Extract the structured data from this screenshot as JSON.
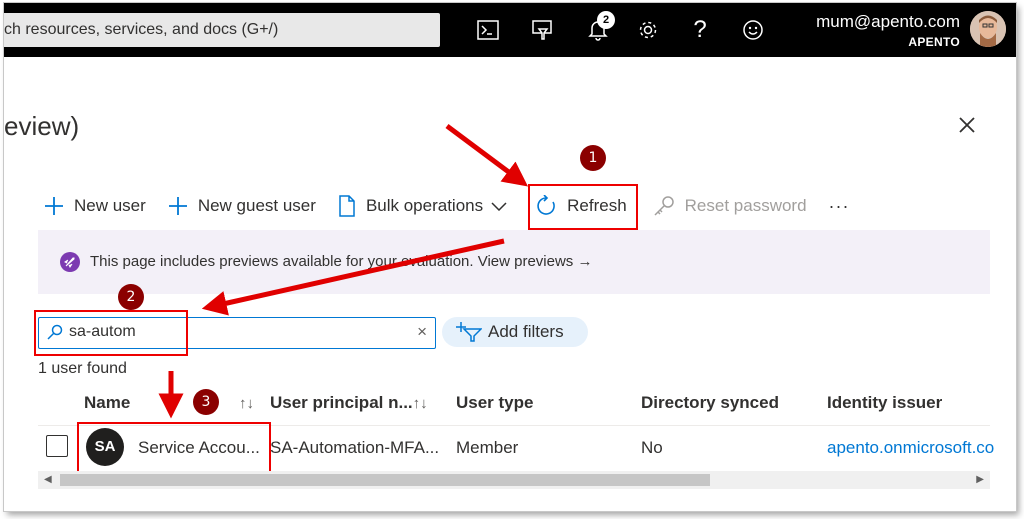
{
  "topbar": {
    "search_text": "ch resources, services, and docs (G+/)",
    "notification_count": "2",
    "account_email": "mum@apento.com",
    "account_org": "APENTO",
    "icons": [
      "cloud-shell-icon",
      "directory-filter-icon",
      "bell-icon",
      "gear-icon",
      "help-icon",
      "feedback-smiley-icon"
    ]
  },
  "page": {
    "title": "eview)"
  },
  "commands": {
    "new_user": "New user",
    "new_guest_user": "New guest user",
    "bulk_operations": "Bulk operations",
    "refresh": "Refresh",
    "reset_password": "Reset password",
    "more": "···"
  },
  "preview_banner": {
    "text": "This page includes previews available for your evaluation. View previews →"
  },
  "search": {
    "value": "sa-autom",
    "clear": "×"
  },
  "add_filters": "Add filters",
  "result_count": "1 user found",
  "table": {
    "columns": [
      "Name",
      "User principal n...",
      "User type",
      "Directory synced",
      "Identity issuer"
    ],
    "sort_glyph": "↑↓",
    "rows": [
      {
        "initials": "SA",
        "name": "Service Accou...",
        "upn": "SA-Automation-MFA...",
        "user_type": "Member",
        "directory_synced": "No",
        "identity_issuer": "apento.onmicrosoft.co"
      }
    ]
  },
  "annotations": {
    "step1": "1",
    "step2": "2",
    "step3": "3"
  },
  "colors": {
    "accent": "#0078d4",
    "highlight_red": "#e00000",
    "step_badge": "#8b0000",
    "topbar": "#000000"
  }
}
